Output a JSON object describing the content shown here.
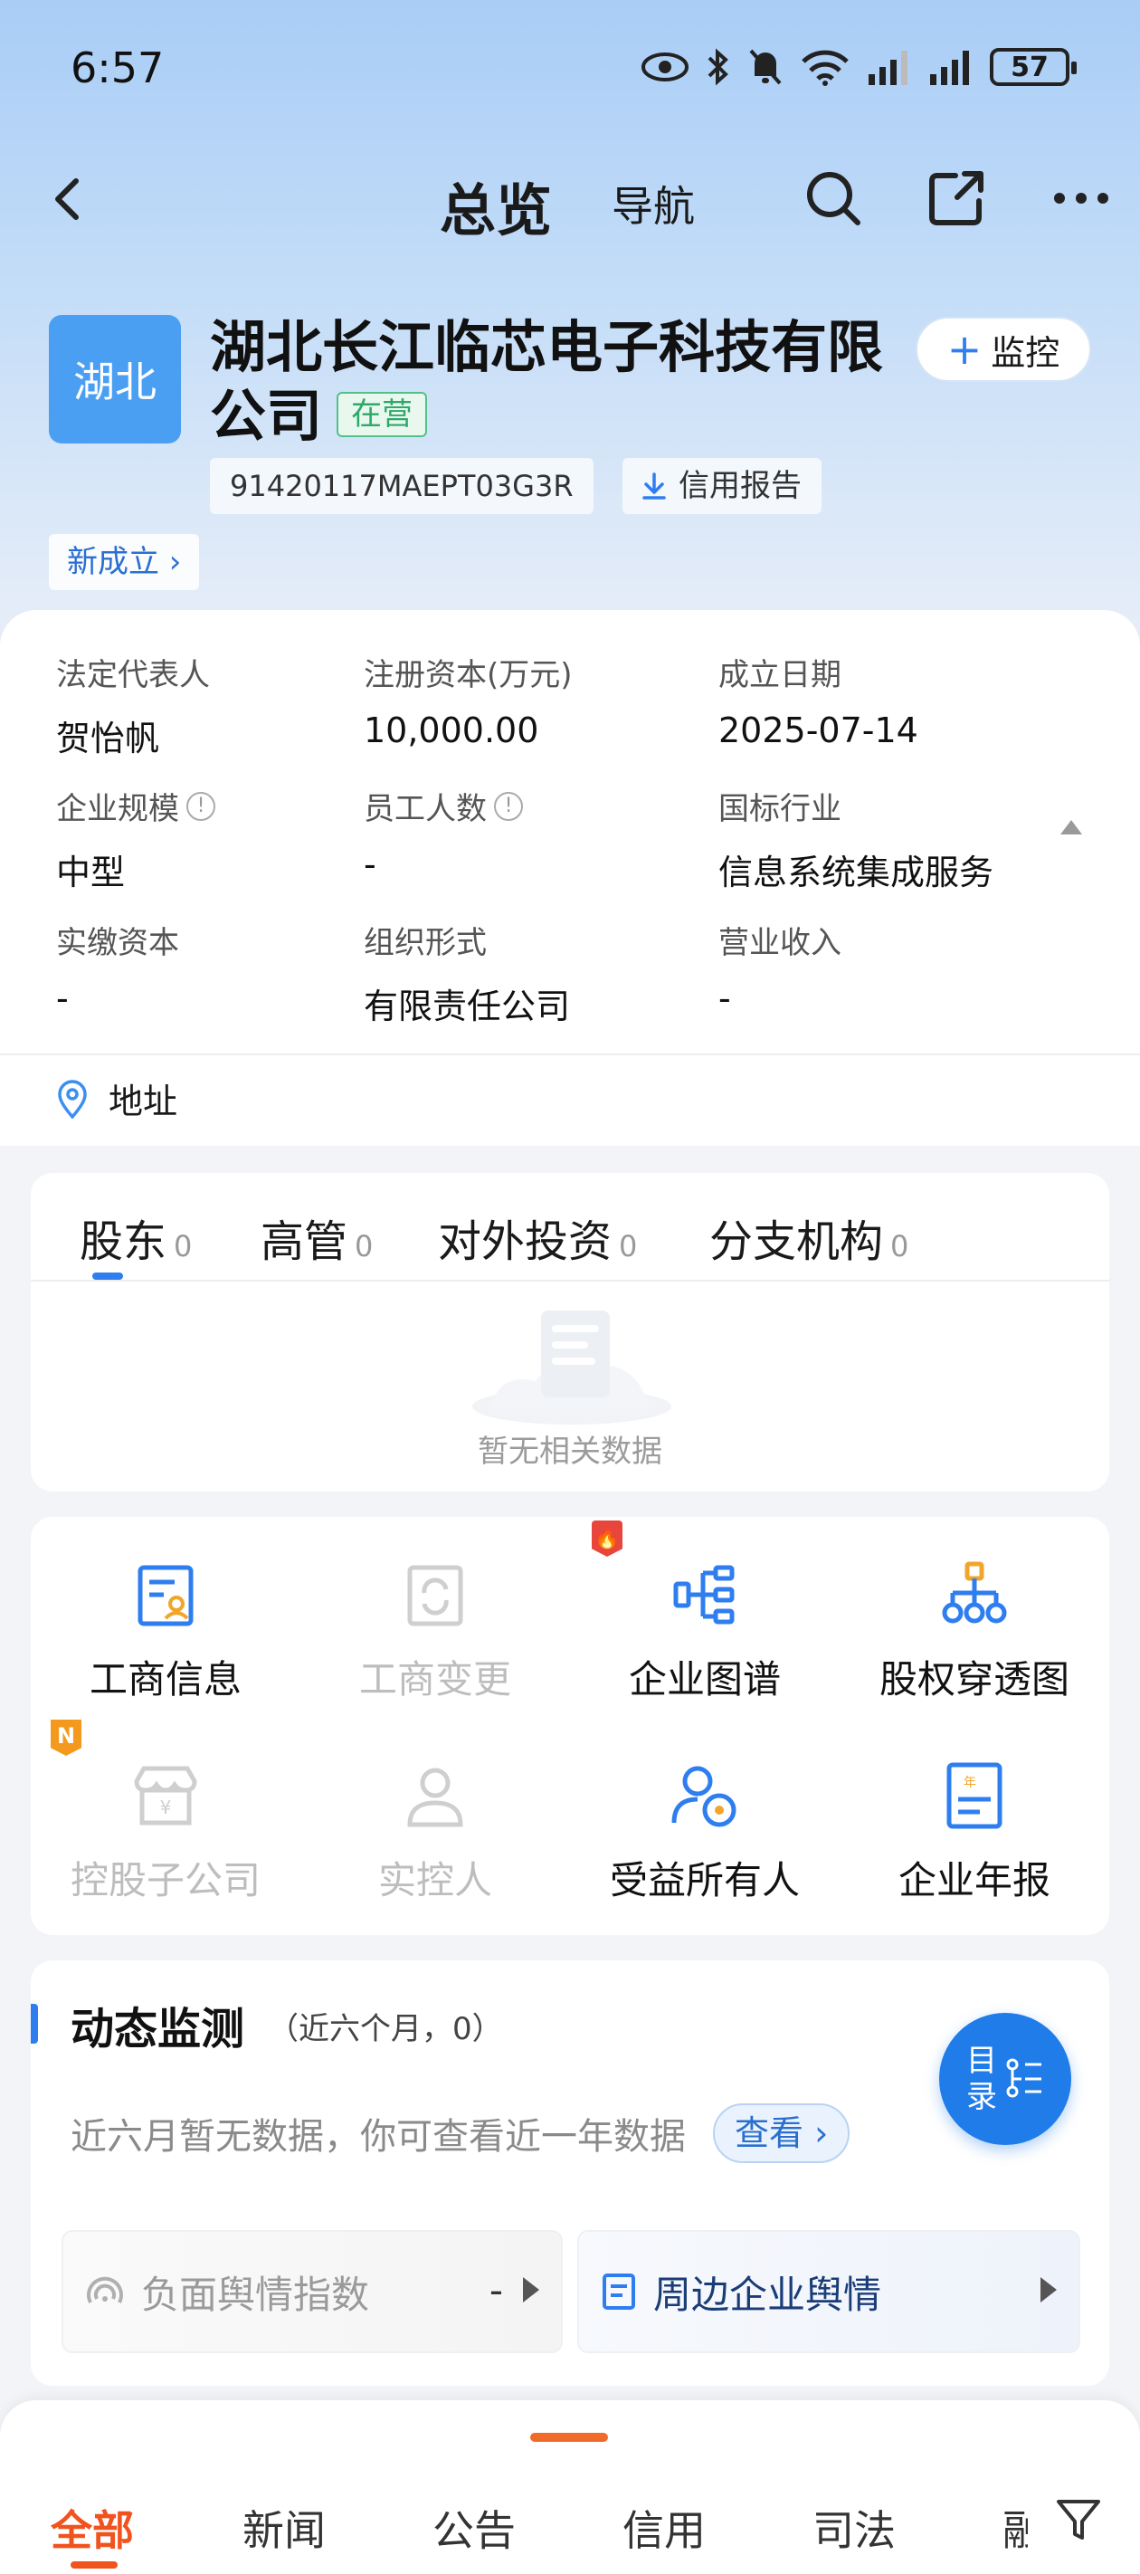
{
  "status_bar": {
    "time": "6:57",
    "battery": "57"
  },
  "nav": {
    "title": "总览",
    "subtitle": "导航"
  },
  "company": {
    "logo_text": "湖北",
    "name": "湖北长江临芯电子科技有限公司",
    "name_line1": "湖北长江临芯电子科技有限",
    "name_line2": "公司",
    "status": "在营",
    "monitor_label": "监控",
    "credit_code": "91420117MAEPT03G3R",
    "credit_report_label": "信用报告",
    "new_tag": "新成立"
  },
  "info": {
    "items": [
      {
        "label": "法定代表人",
        "value": "贺怡帆"
      },
      {
        "label": "注册资本(万元)",
        "value": "10,000.00"
      },
      {
        "label": "成立日期",
        "value": "2025-07-14"
      },
      {
        "label": "企业规模",
        "value": "中型"
      },
      {
        "label": "员工人数",
        "value": "-"
      },
      {
        "label": "国标行业",
        "value": "信息系统集成服务"
      },
      {
        "label": "实缴资本",
        "value": "-"
      },
      {
        "label": "组织形式",
        "value": "有限责任公司"
      },
      {
        "label": "营业收入",
        "value": "-"
      }
    ],
    "address_label": "地址"
  },
  "tabs": {
    "items": [
      {
        "label": "股东",
        "count": "0"
      },
      {
        "label": "高管",
        "count": "0"
      },
      {
        "label": "对外投资",
        "count": "0"
      },
      {
        "label": "分支机构",
        "count": "0"
      }
    ],
    "empty_text": "暂无相关数据"
  },
  "grid": {
    "items": [
      {
        "label": "工商信息"
      },
      {
        "label": "工商变更"
      },
      {
        "label": "企业图谱"
      },
      {
        "label": "股权穿透图"
      },
      {
        "label": "控股子公司"
      },
      {
        "label": "实控人"
      },
      {
        "label": "受益所有人"
      },
      {
        "label": "企业年报"
      }
    ],
    "new_badge": "N"
  },
  "monitor": {
    "title": "动态监测",
    "subtitle": "（近六个月，0）",
    "empty_text": "近六月暂无数据，你可查看近一年数据",
    "view_label": "查看 ›",
    "toc_label": "目录",
    "neg_label": "负面舆情指数",
    "neg_value": "-",
    "near_label": "周边企业舆情"
  },
  "bottom_tabs": {
    "items": [
      "全部",
      "新闻",
      "公告",
      "信用",
      "司法",
      "融"
    ]
  },
  "colors": {
    "accent": "#2f7ef0",
    "active_tab": "#f0531e",
    "status_green": "#2fa86a"
  }
}
